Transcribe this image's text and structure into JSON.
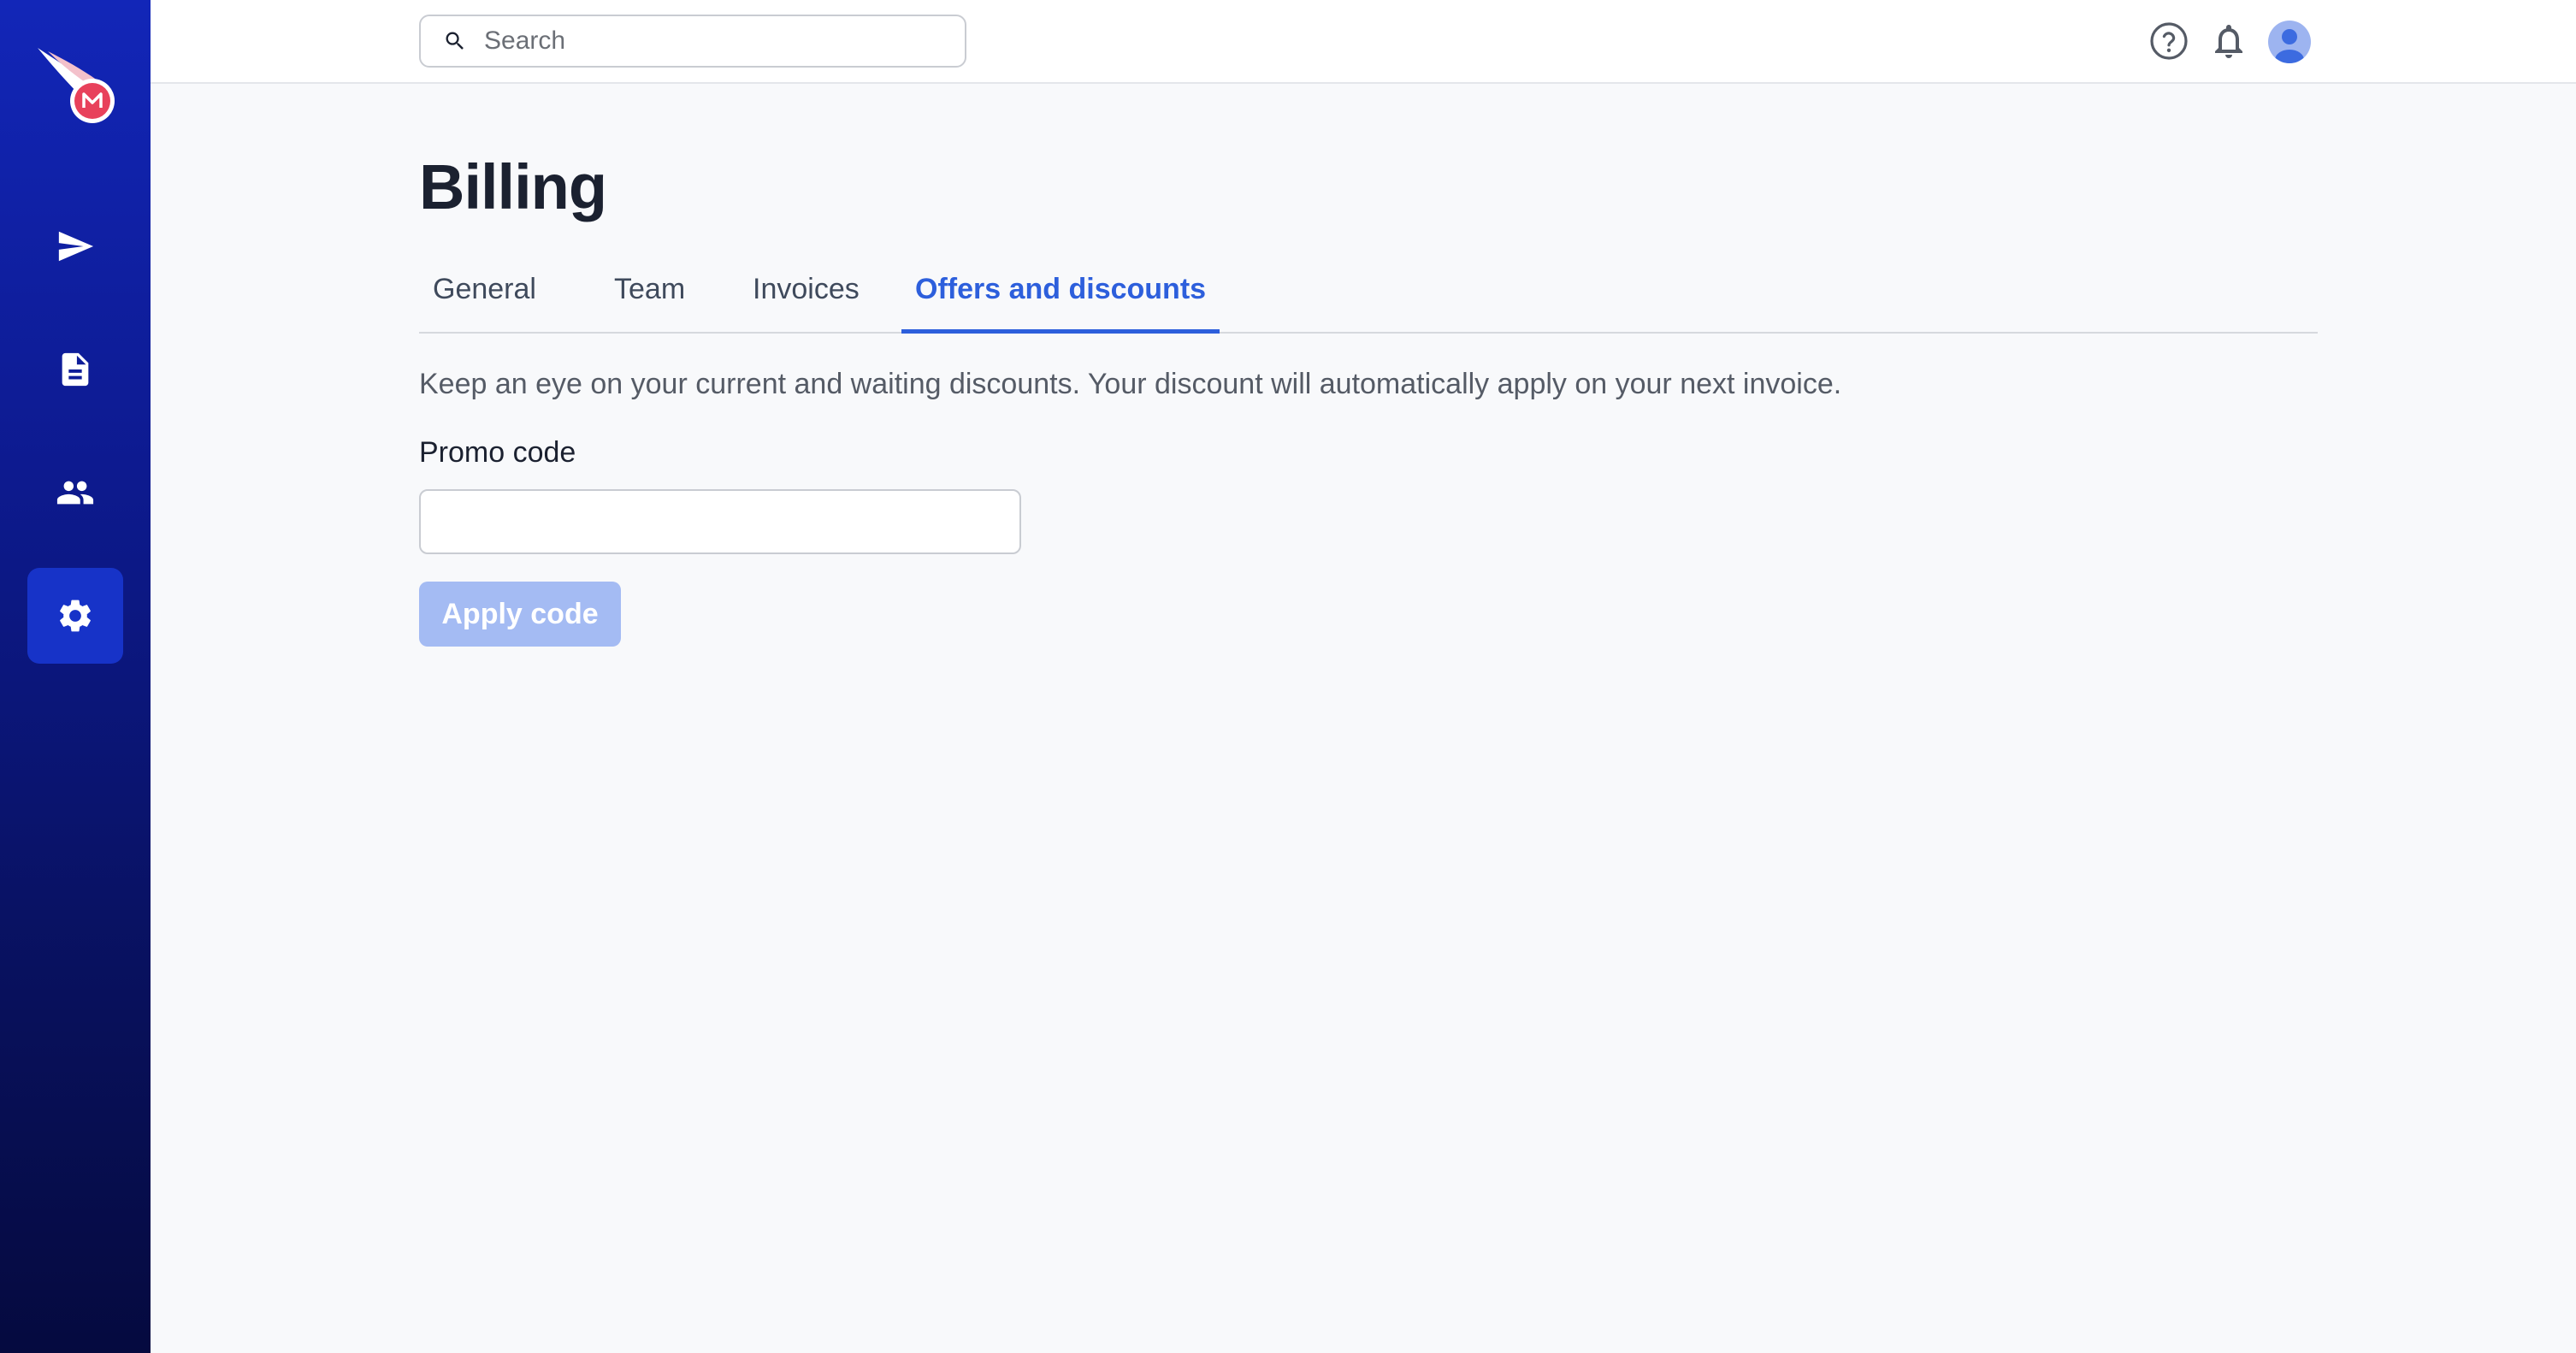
{
  "sidebar": {
    "logo_icon": "comet-logo-icon",
    "items": [
      {
        "name": "send-icon",
        "active": false
      },
      {
        "name": "document-icon",
        "active": false
      },
      {
        "name": "users-icon",
        "active": false
      },
      {
        "name": "gear-icon",
        "active": true
      }
    ],
    "gradient": [
      "#1226b8",
      "#050a3f"
    ],
    "active_color": "#1733c8"
  },
  "topbar": {
    "search": {
      "placeholder": "Search",
      "value": ""
    },
    "icons": [
      "help-icon",
      "bell-icon",
      "avatar"
    ]
  },
  "page": {
    "title": "Billing",
    "tabs": [
      {
        "label": "General",
        "active": false
      },
      {
        "label": "Team",
        "active": false
      },
      {
        "label": "Invoices",
        "active": false
      },
      {
        "label": "Offers and discounts",
        "active": true
      }
    ],
    "description": "Keep an eye on your current and waiting discounts. Your discount will automatically apply on your next invoice.",
    "promo": {
      "label": "Promo code",
      "value": "",
      "placeholder": ""
    },
    "apply_button": "Apply code",
    "apply_button_disabled": true
  },
  "colors": {
    "accent": "#2d5fdc",
    "disabled_button": "#a4bbf3",
    "title": "#1b2130",
    "background": "#f8f9fb"
  }
}
